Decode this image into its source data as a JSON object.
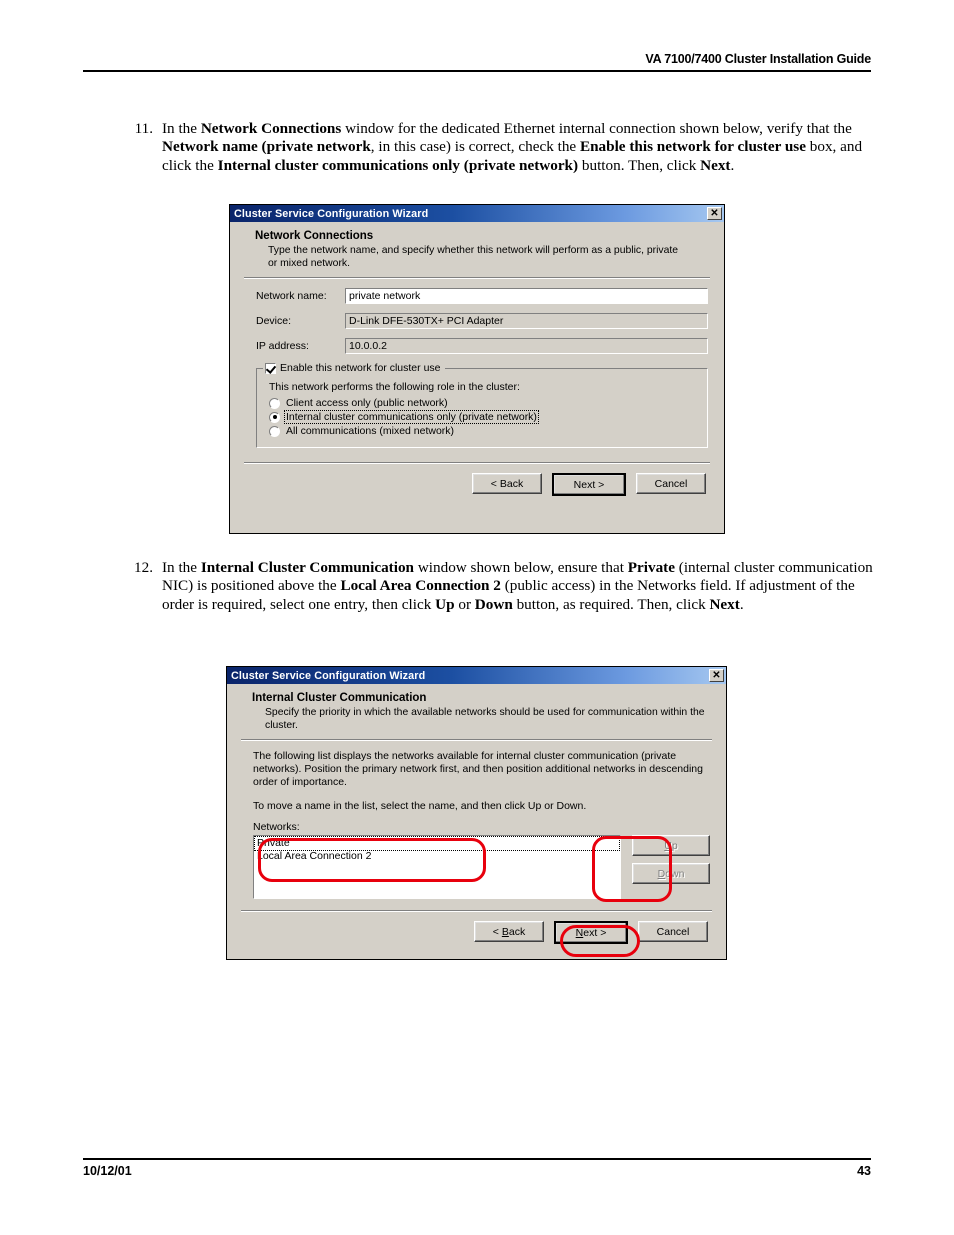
{
  "header": {
    "title": "VA 7100/7400 Cluster Installation Guide"
  },
  "footer": {
    "date": "10/12/01",
    "page_number": "43"
  },
  "steps": [
    {
      "number": "11.",
      "parts": [
        {
          "t": "In the ",
          "b": false
        },
        {
          "t": "Network Connections",
          "b": true
        },
        {
          "t": " window for the dedicated Ethernet internal connection shown below, verify that the ",
          "b": false
        },
        {
          "t": "Network name (private network",
          "b": true
        },
        {
          "t": ", in this case) is correct, check the ",
          "b": false
        },
        {
          "t": "Enable this network for cluster use",
          "b": true
        },
        {
          "t": " box, and click the ",
          "b": false
        },
        {
          "t": "Internal cluster communications only (private network)",
          "b": true
        },
        {
          "t": " button.  Then, click ",
          "b": false
        },
        {
          "t": "Next",
          "b": true
        },
        {
          "t": ".",
          "b": false
        }
      ]
    },
    {
      "number": "12.",
      "parts": [
        {
          "t": "In the ",
          "b": false
        },
        {
          "t": "Internal Cluster Communication",
          "b": true
        },
        {
          "t": " window shown below, ensure that ",
          "b": false
        },
        {
          "t": "Private",
          "b": true
        },
        {
          "t": " (internal cluster communication NIC) is positioned above the ",
          "b": false
        },
        {
          "t": "Local Area Connection 2",
          "b": true
        },
        {
          "t": " (public access) in the Networks field.  If adjustment of the order is required, select one entry, then click ",
          "b": false
        },
        {
          "t": "Up",
          "b": true
        },
        {
          "t": " or ",
          "b": false
        },
        {
          "t": "Down",
          "b": true
        },
        {
          "t": " button, as required.  Then, click ",
          "b": false
        },
        {
          "t": "Next",
          "b": true
        },
        {
          "t": ".",
          "b": false
        }
      ]
    }
  ],
  "dialog1": {
    "titlebar": {
      "title": "Cluster Service Configuration Wizard",
      "close_label": "✕"
    },
    "heading": "Network Connections",
    "subheading": "Type the network name, and specify whether this network will perform as a public, private or mixed network.",
    "fields": [
      {
        "label": "Network name:",
        "value": "private network",
        "editable": true
      },
      {
        "label": "Device:",
        "value": "D-Link DFE-530TX+ PCI Adapter",
        "editable": false
      },
      {
        "label": "IP address:",
        "value": "10.0.0.2",
        "editable": false
      }
    ],
    "groupbox": {
      "checkbox_label": "Enable this network for cluster use",
      "checked": true,
      "caption": "This network performs the following role in the cluster:",
      "options": [
        {
          "label": "Client access only (public network)",
          "selected": false,
          "focused": false
        },
        {
          "label": "Internal cluster communications only (private network)",
          "selected": true,
          "focused": true
        },
        {
          "label": "All communications (mixed network)",
          "selected": false,
          "focused": false
        }
      ]
    },
    "buttons": {
      "back": "< Back",
      "next": "Next >",
      "cancel": "Cancel"
    }
  },
  "dialog2": {
    "titlebar": {
      "title": "Cluster Service Configuration Wizard",
      "close_label": "✕"
    },
    "heading": "Internal Cluster Communication",
    "subheading": "Specify the priority in which the available networks should be used for communication within the cluster.",
    "paragraph1": "The following list displays the networks available for internal cluster communication (private networks). Position the primary network first, and then position additional networks in descending order of importance.",
    "paragraph2": "To move a name in the list, select the name, and then click Up or Down.",
    "list_label": "Networks:",
    "list_items": [
      {
        "label": "Private",
        "focused": true
      },
      {
        "label": "Local Area Connection 2",
        "focused": false
      }
    ],
    "side_buttons": [
      {
        "label_pre": "U",
        "label_mnemonic": "p",
        "label": "Up",
        "disabled": true
      },
      {
        "label_pre": "",
        "label_mnemonic": "D",
        "label": "Down",
        "disabled": true
      }
    ],
    "buttons": {
      "back_mnemonic": "B",
      "back_pre": "< ",
      "back_post": "ack",
      "back": "< Back",
      "next_mnemonic": "N",
      "next_post": "ext >",
      "next": "Next >",
      "cancel": "Cancel"
    }
  },
  "annotations": {
    "color": "#e8000d",
    "shapes": [
      {
        "name": "networks-list-highlight"
      },
      {
        "name": "up-down-buttons-highlight"
      },
      {
        "name": "next-button-highlight"
      }
    ]
  }
}
